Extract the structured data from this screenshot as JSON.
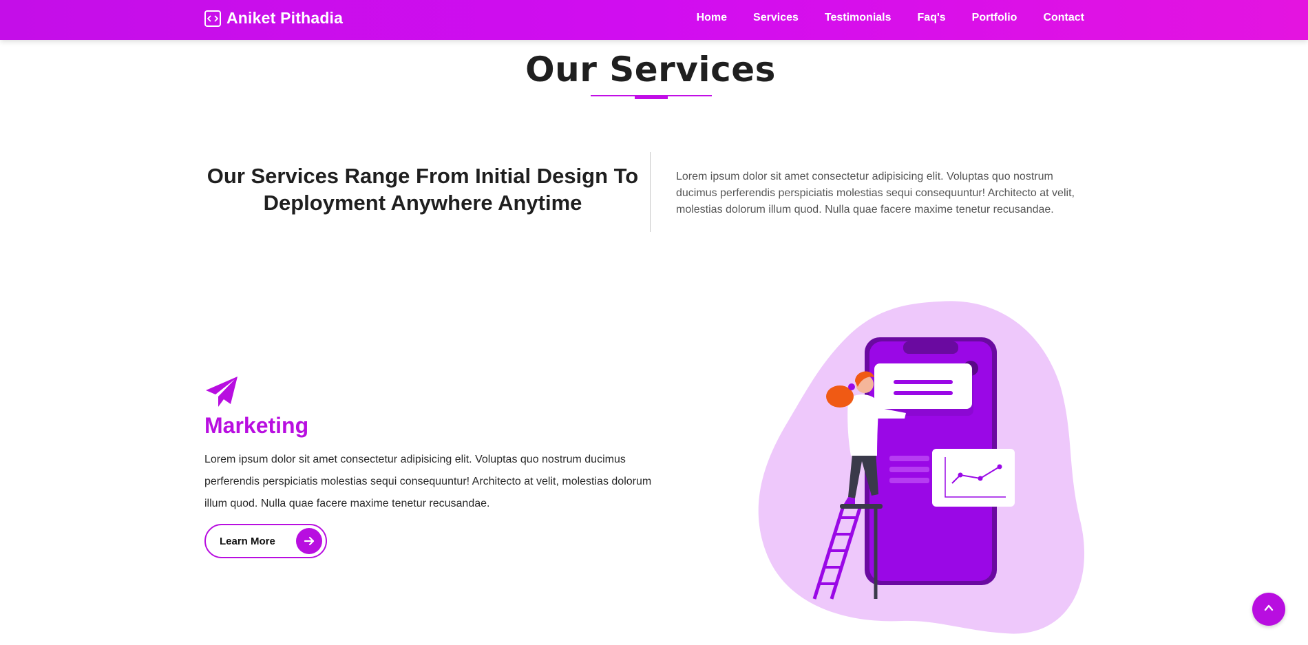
{
  "brand": {
    "name": "Aniket Pithadia",
    "icon": "code-icon"
  },
  "nav": {
    "items": [
      {
        "label": "Home"
      },
      {
        "label": "Services"
      },
      {
        "label": "Testimonials"
      },
      {
        "label": "Faq's"
      },
      {
        "label": "Portfolio"
      },
      {
        "label": "Contact"
      }
    ]
  },
  "section": {
    "title": "Our Services"
  },
  "intro": {
    "heading": "Our Services Range From Initial Design To Deployment Anywhere Anytime",
    "text": "Lorem ipsum dolor sit amet consectetur adipisicing elit. Voluptas quo nostrum ducimus perferendis perspiciatis molestias sequi consequuntur! Architecto at velit, molestias dolorum illum quod. Nulla quae facere maxime tenetur recusandae."
  },
  "service": {
    "icon": "paper-plane-icon",
    "title": "Marketing",
    "description": "Lorem ipsum dolor sit amet consectetur adipisicing elit. Voluptas quo nostrum ducimus perferendis perspiciatis molestias sequi consequuntur! Architecto at velit, molestias dolorum illum quod. Nulla quae facere maxime tenetur recusandae.",
    "button_label": "Learn More"
  },
  "colors": {
    "accent": "#b80ee0",
    "nav_gradient_start": "#c40ee8",
    "nav_gradient_end": "#e414e0",
    "blob": "#eec8fb"
  }
}
